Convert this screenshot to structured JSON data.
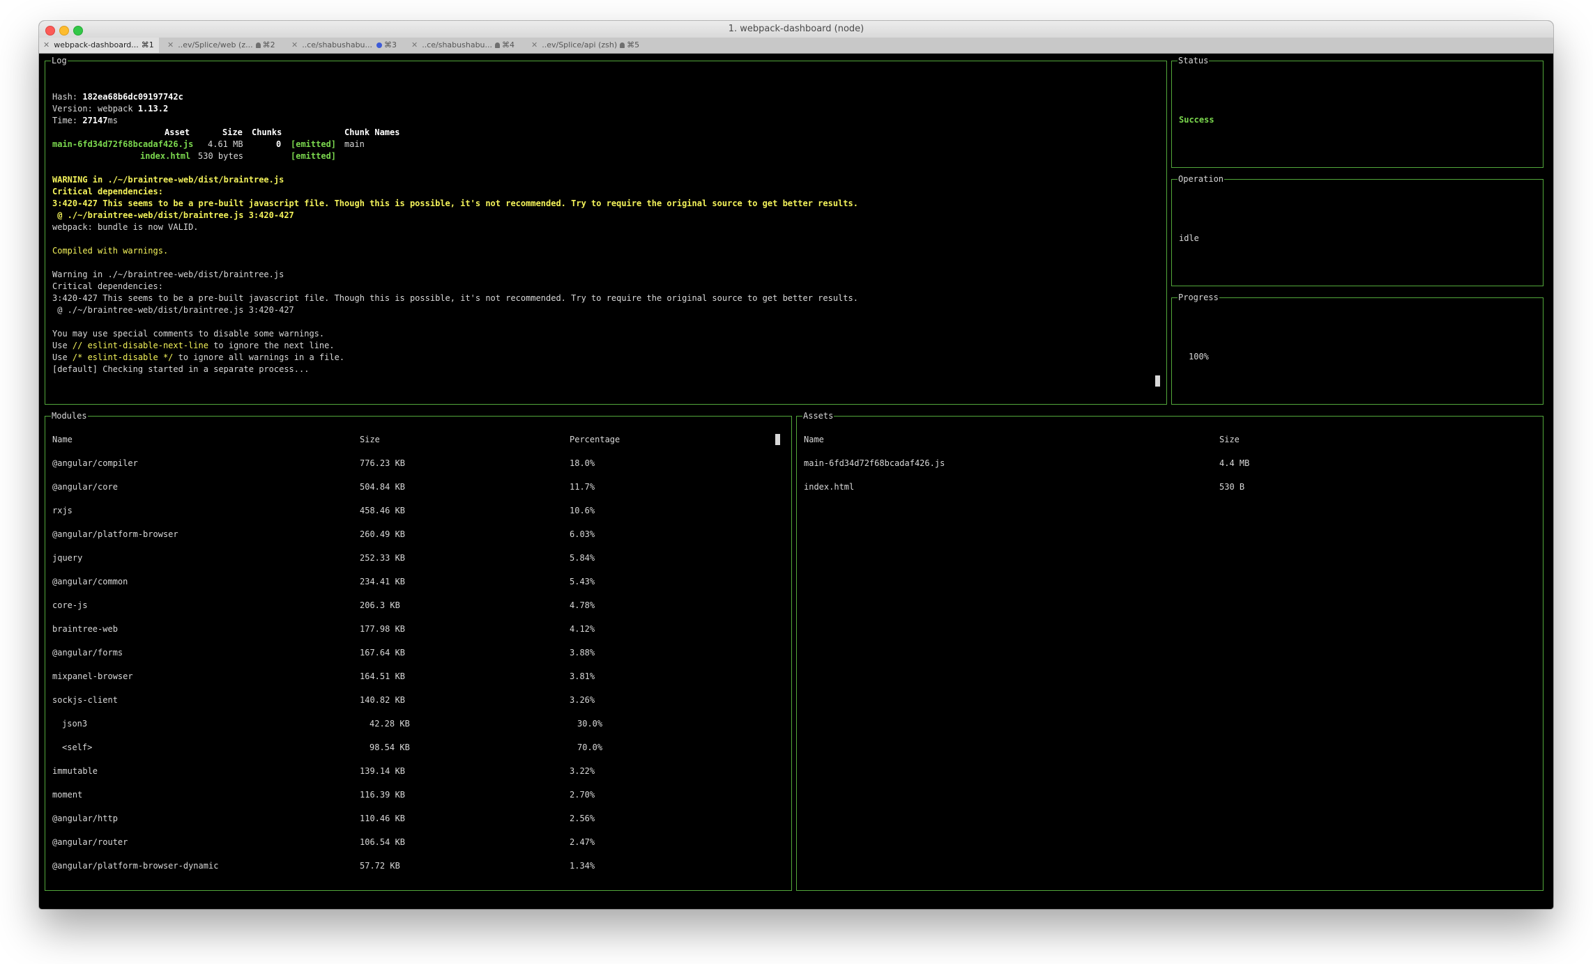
{
  "window": {
    "title": "1. webpack-dashboard (node)"
  },
  "tabs": [
    {
      "label": "webpack-dashboard...",
      "shortcut": "⌘1",
      "active": true
    },
    {
      "label": "..ev/Splice/web (z...",
      "shortcut": "⌘2",
      "bell": true
    },
    {
      "label": "..ce/shabushabu...",
      "shortcut": "⌘3",
      "dot": true
    },
    {
      "label": "..ce/shabushabu...",
      "shortcut": "⌘4",
      "bell": true
    },
    {
      "label": "..ev/Splice/api (zsh)",
      "shortcut": "⌘5",
      "bell": true
    }
  ],
  "log": {
    "title": "Log",
    "hash_label": "Hash: ",
    "hash": "182ea68b6dc09197742c",
    "version_label": "Version: webpack ",
    "version": "1.13.2",
    "time_label": "Time: ",
    "time": "27147",
    "time_unit": "ms",
    "table_headers": {
      "asset": "Asset",
      "size": "Size",
      "chunks": "Chunks",
      "chunk_names": "Chunk Names"
    },
    "asset1": {
      "name": "main-6fd34d72f68bcadaf426.js",
      "size": "4.61 MB",
      "chunk": "0",
      "emitted": "[emitted]",
      "chunk_name": "main"
    },
    "asset2": {
      "name": "index.html",
      "size": "530 bytes",
      "emitted": "[emitted]"
    },
    "warning_line": "WARNING in ./~/braintree-web/dist/braintree.js",
    "critical_line": "Critical dependencies:",
    "prebuilt_line": "3:420-427 This seems to be a pre-built javascript file. Though this is possible, it's not recommended. Try to require the original source to get better results.",
    "at_line": " @ ./~/braintree-web/dist/braintree.js 3:420-427",
    "valid_line": "webpack: bundle is now VALID.",
    "compiled_line": "Compiled with warnings.",
    "warning2_line": "Warning in ./~/braintree-web/dist/braintree.js",
    "critical2_line": "Critical dependencies:",
    "prebuilt2_line": "3:420-427 This seems to be a pre-built javascript file. Though this is possible, it's not recommended. Try to require the original source to get better results.",
    "at2_line": " @ ./~/braintree-web/dist/braintree.js 3:420-427",
    "comments_line": "You may use special comments to disable some warnings.",
    "use_label": "Use ",
    "eslint_next": "// eslint-disable-next-line",
    "eslint_next_suffix": " to ignore the next line.",
    "eslint_all": "/* eslint-disable */",
    "eslint_all_suffix": " to ignore all warnings in a file.",
    "checking_line": "[default] Checking started in a separate process..."
  },
  "status": {
    "title": "Status",
    "value": "Success",
    "color": "#7bd84e"
  },
  "operation": {
    "title": "Operation",
    "value": "idle"
  },
  "progress": {
    "title": "Progress",
    "value": "100%"
  },
  "modules": {
    "title": "Modules",
    "headers": {
      "name": "Name",
      "size": "Size",
      "percentage": "Percentage"
    },
    "rows": [
      {
        "name": "@angular/compiler",
        "size": "776.23 KB",
        "pct": "18.0%"
      },
      {
        "name": "@angular/core",
        "size": "504.84 KB",
        "pct": "11.7%"
      },
      {
        "name": "rxjs",
        "size": "458.46 KB",
        "pct": "10.6%"
      },
      {
        "name": "@angular/platform-browser",
        "size": "260.49 KB",
        "pct": "6.03%"
      },
      {
        "name": "jquery",
        "size": "252.33 KB",
        "pct": "5.84%"
      },
      {
        "name": "@angular/common",
        "size": "234.41 KB",
        "pct": "5.43%"
      },
      {
        "name": "core-js",
        "size": "206.3 KB",
        "pct": "4.78%"
      },
      {
        "name": "braintree-web",
        "size": "177.98 KB",
        "pct": "4.12%"
      },
      {
        "name": "@angular/forms",
        "size": "167.64 KB",
        "pct": "3.88%"
      },
      {
        "name": "mixpanel-browser",
        "size": "164.51 KB",
        "pct": "3.81%"
      },
      {
        "name": "sockjs-client",
        "size": "140.82 KB",
        "pct": "3.26%"
      },
      {
        "name": "json3",
        "size": "42.28 KB",
        "pct": "30.0%",
        "nested": true
      },
      {
        "name": "<self>",
        "size": "98.54 KB",
        "pct": "70.0%",
        "nested": true
      },
      {
        "name": "immutable",
        "size": "139.14 KB",
        "pct": "3.22%"
      },
      {
        "name": "moment",
        "size": "116.39 KB",
        "pct": "2.70%"
      },
      {
        "name": "@angular/http",
        "size": "110.46 KB",
        "pct": "2.56%"
      },
      {
        "name": "@angular/router",
        "size": "106.54 KB",
        "pct": "2.47%"
      },
      {
        "name": "@angular/platform-browser-dynamic",
        "size": "57.72 KB",
        "pct": "1.34%"
      }
    ]
  },
  "assets": {
    "title": "Assets",
    "headers": {
      "name": "Name",
      "size": "Size"
    },
    "rows": [
      {
        "name": "main-6fd34d72f68bcadaf426.js",
        "size": "4.4 MB"
      },
      {
        "name": "index.html",
        "size": "530 B"
      }
    ]
  }
}
